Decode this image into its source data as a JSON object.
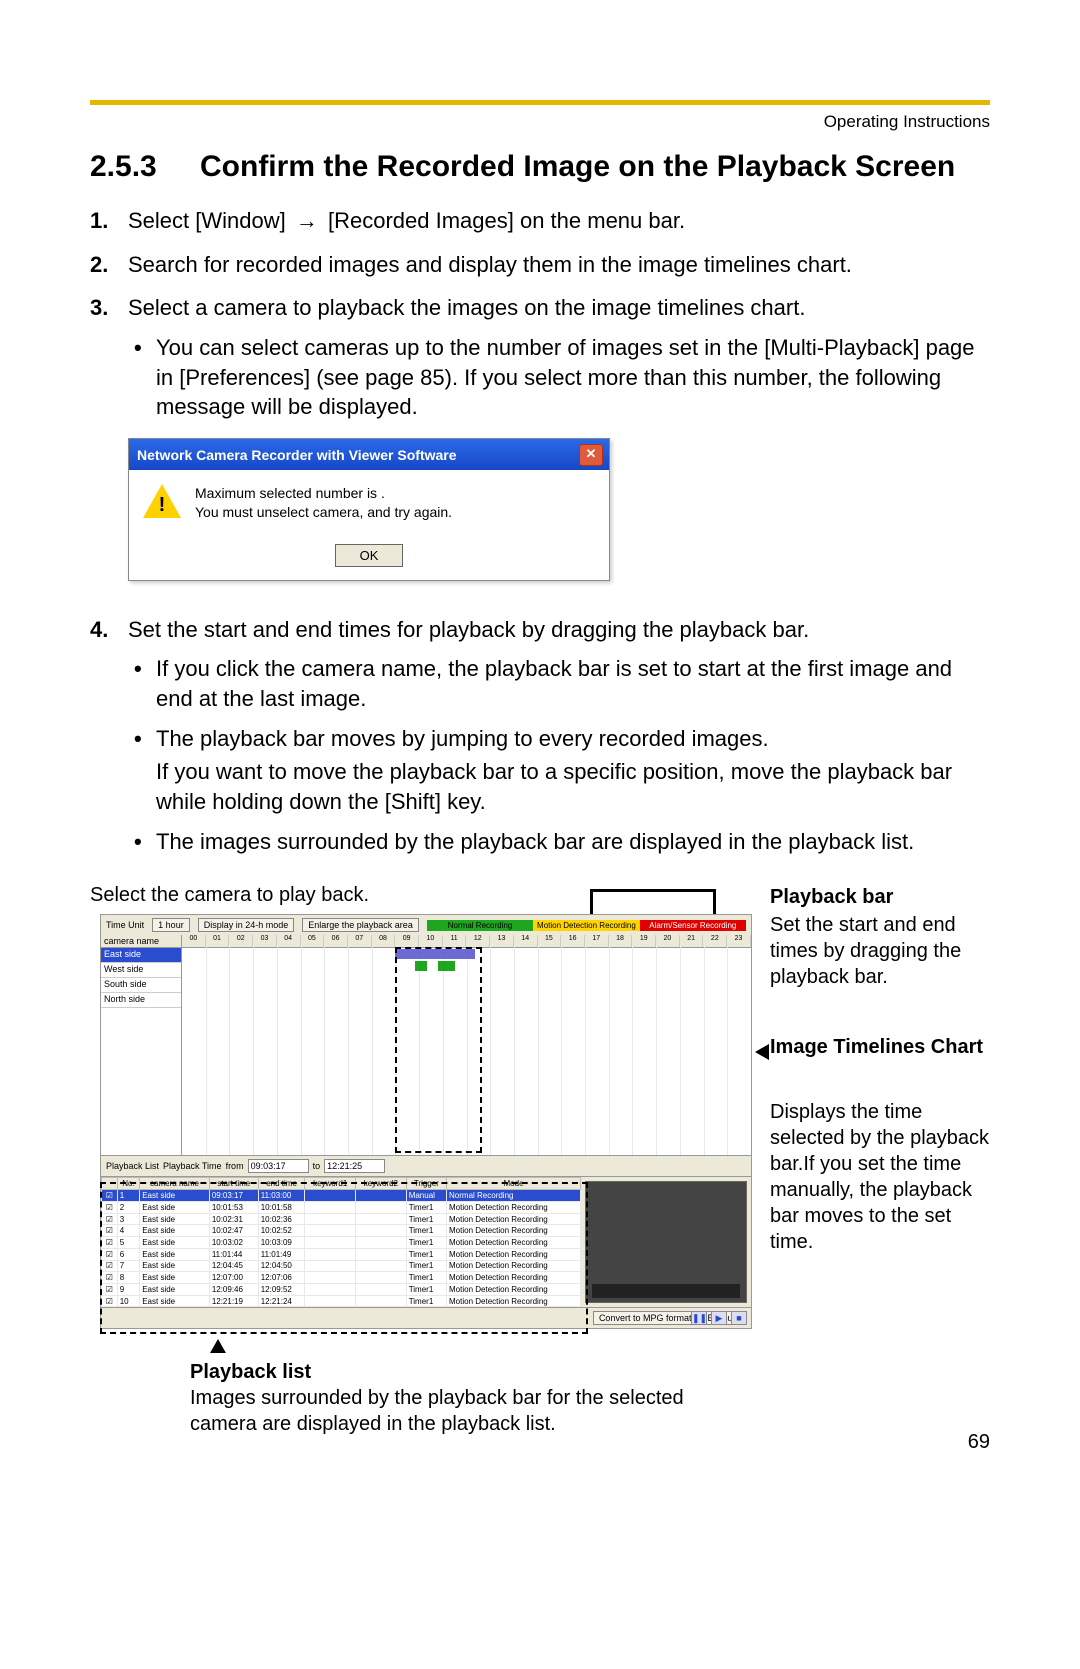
{
  "runhead": "Operating Instructions",
  "section": {
    "number": "2.5.3",
    "title": "Confirm the Recorded Image on the Playback Screen"
  },
  "steps": {
    "s1_a": "Select [Window]",
    "s1_b": "[Recorded Images] on the menu bar.",
    "s2": "Search for recorded images and display them in the image timelines chart.",
    "s3": "Select a camera to playback the images on the image timelines chart.",
    "s3_b1": "You can select cameras up to the number of images set in the [Multi-Playback] page in [Preferences] (see page 85). If you select more than this number, the following message will be displayed.",
    "s4": "Set the start and end times for playback by dragging the playback bar.",
    "s4_b1": "If you click the camera name, the playback bar is set to start at the first image and end at the last image.",
    "s4_b2": "The playback bar moves by jumping to every recorded images.",
    "s4_b2_sub": "If you want to move the playback bar to a specific position, move the playback bar while holding down the [Shift] key.",
    "s4_b3": "The images surrounded by the playback bar are displayed in the playback list."
  },
  "dialog": {
    "title": "Network Camera Recorder with Viewer Software",
    "line1": "Maximum selected number is .",
    "line2": "You must unselect camera, and try again.",
    "ok": "OK"
  },
  "figure": {
    "select_cam": "Select the camera to play back.",
    "playback_bar_title": "Playback bar",
    "playback_bar_text": "Set the start and end times by dragging the playback bar.",
    "timelines_title": "Image Timelines Chart",
    "displays_time": "Displays the time selected by the playback bar.If you set the time manually, the playback bar moves to the set time.",
    "playback_list_title": "Playback list",
    "playback_list_text": "Images surrounded by the playback bar for the selected camera are displayed in the playback list."
  },
  "ui": {
    "time_unit_label": "Time Unit",
    "time_unit_value": "1 hour",
    "display24": "Display in 24-h mode",
    "enlarge": "Enlarge the playback area",
    "legend": {
      "normal": "Normal Recording",
      "motion": "Motion Detection Recording",
      "alarm": "Alarm/Sensor Recording"
    },
    "camera_name_header": "camera name",
    "cams": [
      "East side",
      "West side",
      "South side",
      "North side"
    ],
    "hours": [
      "00",
      "01",
      "02",
      "03",
      "04",
      "05",
      "06",
      "07",
      "08",
      "09",
      "10",
      "11",
      "12",
      "13",
      "14",
      "15",
      "16",
      "17",
      "18",
      "19",
      "20",
      "21",
      "22",
      "23"
    ],
    "playback_list_label": "Playback List",
    "playback_time_label": "Playback Time",
    "from": "from",
    "to": "to",
    "t_from": "09:03:17",
    "t_to": "12:21:25",
    "headers": {
      "chk": "",
      "no": "No.",
      "cam": "camera name",
      "start": "start time",
      "end": "end time",
      "kw1": "keyword1",
      "kw2": "keyword2",
      "trigger": "Trigger",
      "mode": "Mode"
    },
    "rows": [
      {
        "no": "1",
        "cam": "East side",
        "start": "09:03:17",
        "end": "11:03:00",
        "trigger": "Manual",
        "mode": "Normal Recording",
        "sel": true,
        "mn": true
      },
      {
        "no": "2",
        "cam": "East side",
        "start": "10:01:53",
        "end": "10:01:58",
        "trigger": "Timer1",
        "mode": "Motion Detection Recording"
      },
      {
        "no": "3",
        "cam": "East side",
        "start": "10:02:31",
        "end": "10:02:36",
        "trigger": "Timer1",
        "mode": "Motion Detection Recording"
      },
      {
        "no": "4",
        "cam": "East side",
        "start": "10:02:47",
        "end": "10:02:52",
        "trigger": "Timer1",
        "mode": "Motion Detection Recording"
      },
      {
        "no": "5",
        "cam": "East side",
        "start": "10:03:02",
        "end": "10:03:09",
        "trigger": "Timer1",
        "mode": "Motion Detection Recording"
      },
      {
        "no": "6",
        "cam": "East side",
        "start": "11:01:44",
        "end": "11:01:49",
        "trigger": "Timer1",
        "mode": "Motion Detection Recording"
      },
      {
        "no": "7",
        "cam": "East side",
        "start": "12:04:45",
        "end": "12:04:50",
        "trigger": "Timer1",
        "mode": "Motion Detection Recording"
      },
      {
        "no": "8",
        "cam": "East side",
        "start": "12:07:00",
        "end": "12:07:06",
        "trigger": "Timer1",
        "mode": "Motion Detection Recording"
      },
      {
        "no": "9",
        "cam": "East side",
        "start": "12:09:46",
        "end": "12:09:52",
        "trigger": "Timer1",
        "mode": "Motion Detection Recording"
      },
      {
        "no": "10",
        "cam": "East side",
        "start": "12:21:19",
        "end": "12:21:24",
        "trigger": "Timer1",
        "mode": "Motion Detection Recording"
      }
    ],
    "convert": "Convert to MPG format",
    "execute": "Execute"
  },
  "page_number": "69"
}
